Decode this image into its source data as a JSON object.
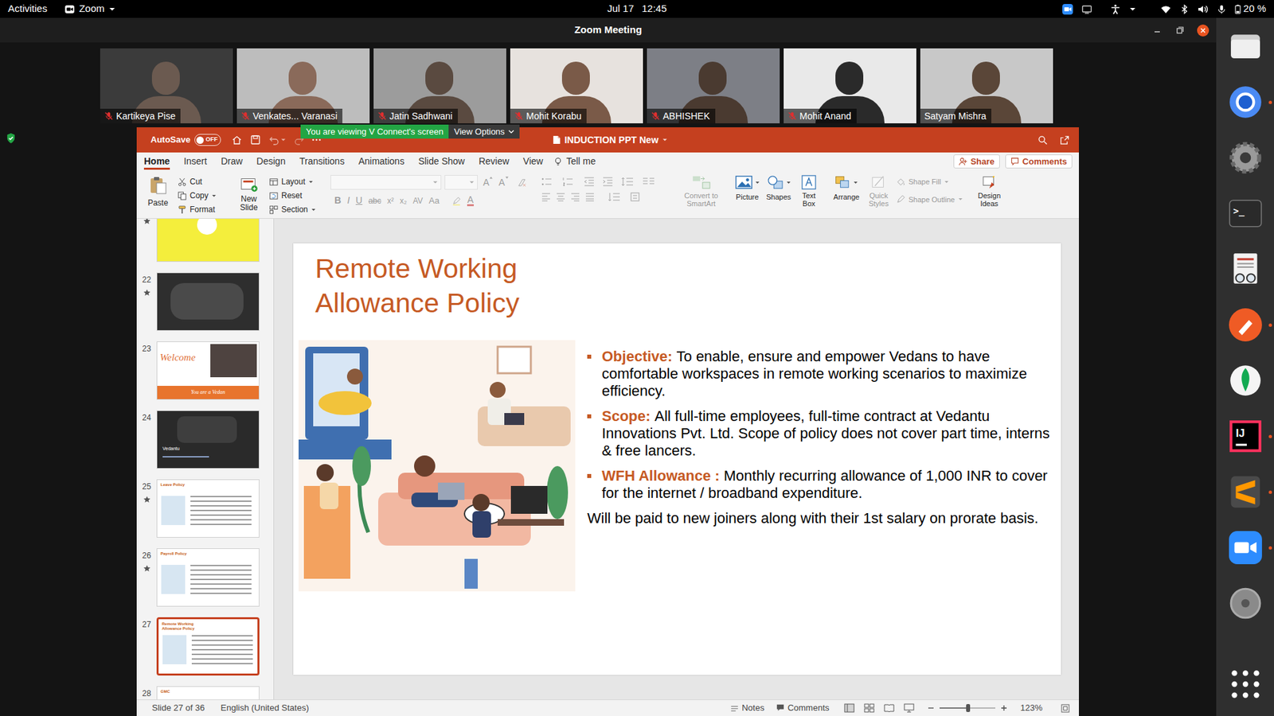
{
  "topbar": {
    "activities": "Activities",
    "app": "Zoom",
    "date": "Jul 17",
    "time": "12:45",
    "battery": "20 %"
  },
  "zoom_window": {
    "title": "Zoom Meeting"
  },
  "participants": [
    {
      "name": "Kartikeya Pise",
      "muted": true
    },
    {
      "name": "Venkates... Varanasi",
      "muted": true
    },
    {
      "name": "Jatin Sadhwani",
      "muted": true
    },
    {
      "name": "Mohit Korabu",
      "muted": true
    },
    {
      "name": "ABHISHEK",
      "muted": true
    },
    {
      "name": "Mohit Anand",
      "muted": true
    },
    {
      "name": "Satyam Mishra",
      "muted": false
    }
  ],
  "share_banner": {
    "text": "You are viewing V Connect's screen",
    "options": "View Options"
  },
  "ppt": {
    "titlebar": {
      "autosave": "AutoSave",
      "autosave_state": "OFF",
      "autosave_on": false,
      "doc_title": "INDUCTION PPT New"
    },
    "tabs": [
      {
        "label": "Home",
        "selected": true
      },
      {
        "label": "Insert",
        "selected": false
      },
      {
        "label": "Draw",
        "selected": false
      },
      {
        "label": "Design",
        "selected": false
      },
      {
        "label": "Transitions",
        "selected": false
      },
      {
        "label": "Animations",
        "selected": false
      },
      {
        "label": "Slide Show",
        "selected": false
      },
      {
        "label": "Review",
        "selected": false
      },
      {
        "label": "View",
        "selected": false
      }
    ],
    "tell_me": "Tell me",
    "share": "Share",
    "comments": "Comments",
    "ribbon": {
      "paste": {
        "label": "Paste",
        "disabled": false
      },
      "cut": {
        "label": "Cut",
        "disabled": false
      },
      "copy": {
        "label": "Copy",
        "disabled": false
      },
      "format": {
        "label": "Format",
        "disabled": false
      },
      "new_slide": {
        "label": "New Slide",
        "disabled": false
      },
      "layout": {
        "label": "Layout",
        "disabled": false
      },
      "reset": {
        "label": "Reset",
        "disabled": false
      },
      "section": {
        "label": "Section",
        "disabled": false
      },
      "font_group": {
        "disabled": true,
        "row1": [
          "A",
          "A"
        ],
        "row2": [
          "B",
          "I",
          "U",
          "abc",
          "x²",
          "x₂",
          "AV",
          "Aa"
        ],
        "color_glyph": "A"
      },
      "paragraph_group": {
        "disabled": true
      },
      "convert": {
        "label": "Convert to SmartArt",
        "disabled": true
      },
      "picture": {
        "label": "Picture",
        "disabled": false
      },
      "shapes": {
        "label": "Shapes",
        "disabled": false
      },
      "textbox": {
        "label": "Text Box",
        "disabled": false
      },
      "arrange": {
        "label": "Arrange",
        "disabled": false
      },
      "quick_styles": {
        "label": "Quick Styles",
        "disabled": true
      },
      "shape_fill": {
        "label": "Shape Fill",
        "disabled": true
      },
      "shape_outline": {
        "label": "Shape Outline",
        "disabled": true
      },
      "design_ideas": {
        "label": "Design Ideas",
        "disabled": false
      }
    },
    "thumbnails": [
      {
        "starred": true,
        "selected": false,
        "kind": "yellow"
      },
      {
        "number": "22",
        "starred": true,
        "selected": false,
        "kind": "dark"
      },
      {
        "number": "23",
        "starred": false,
        "selected": false,
        "kind": "welcome",
        "title": "Welcome",
        "caption": "You are a Vedan"
      },
      {
        "number": "24",
        "starred": false,
        "selected": false,
        "kind": "photo",
        "caption": "Vedantu"
      },
      {
        "number": "25",
        "starred": true,
        "selected": false,
        "kind": "text",
        "title": "Leave Policy"
      },
      {
        "number": "26",
        "starred": true,
        "selected": false,
        "kind": "text",
        "title": "Payroll Policy"
      },
      {
        "number": "27",
        "starred": false,
        "selected": true,
        "kind": "text",
        "title": "Remote Working Allowance Policy"
      },
      {
        "number": "28",
        "starred": false,
        "selected": false,
        "kind": "text",
        "title": "GMC"
      }
    ],
    "slide": {
      "title_lines": [
        "Remote Working",
        "Allowance Policy"
      ],
      "bullets": [
        {
          "label": "Objective:",
          "text": "To enable, ensure and empower Vedans to have comfortable workspaces in remote working scenarios to maximize efficiency."
        },
        {
          "label": "Scope:",
          "text": "All full-time employees, full-time contract at Vedantu Innovations Pvt. Ltd. Scope of policy does not cover part time, interns & free lancers."
        },
        {
          "label": "WFH Allowance :",
          "text": "Monthly recurring allowance of 1,000 INR to cover for the internet / broadband expenditure."
        }
      ],
      "note": "Will be paid to new joiners along with their 1st salary on prorate basis."
    },
    "status": {
      "slide_info": "Slide 27 of 36",
      "language": "English (United States)",
      "notes": "Notes",
      "comments": "Comments",
      "zoom": "123%",
      "zoom_level": 0.52
    }
  },
  "dock": [
    {
      "kind": "files",
      "running": false
    },
    {
      "kind": "chromium",
      "running": true
    },
    {
      "kind": "settings",
      "running": false
    },
    {
      "kind": "terminal",
      "running": false,
      "glyph": ">_"
    },
    {
      "kind": "viewer",
      "running": false
    },
    {
      "kind": "postman",
      "running": true
    },
    {
      "kind": "mongodb",
      "running": false
    },
    {
      "kind": "intellij",
      "running": true,
      "glyph": "IJ"
    },
    {
      "kind": "sublime",
      "running": true
    },
    {
      "kind": "zoom",
      "running": true
    },
    {
      "kind": "disk",
      "running": false
    },
    {
      "kind": "apps",
      "running": false
    }
  ]
}
